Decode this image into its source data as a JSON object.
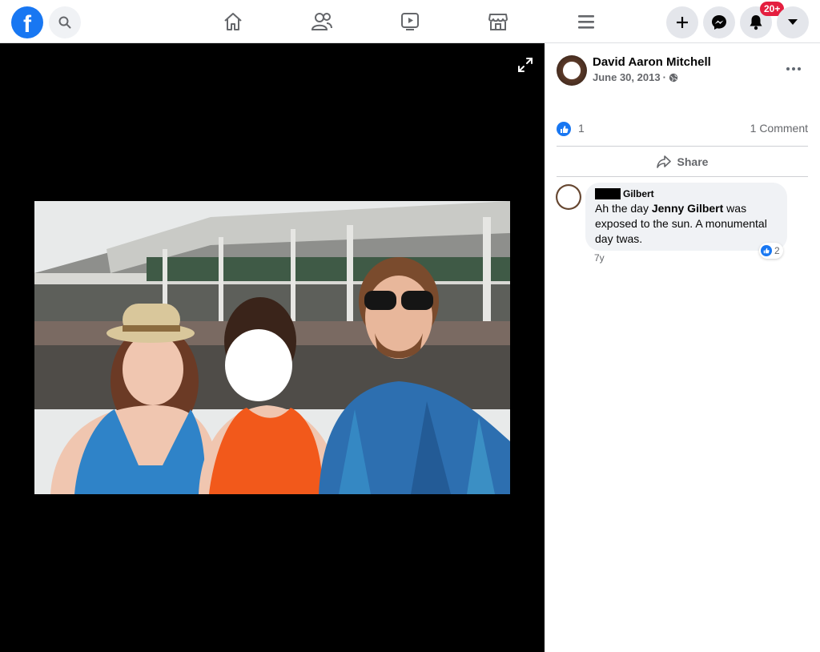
{
  "nav": {
    "logo_letter": "f",
    "search_icon": "search-icon",
    "items": [
      "home-icon",
      "friends-icon",
      "watch-icon",
      "marketplace-icon",
      "menu-icon"
    ],
    "actions": [
      "create-icon",
      "messenger-icon",
      "notifications-icon",
      "account-icon"
    ],
    "notifications_badge": "20+"
  },
  "post": {
    "author": "David Aaron Mitchell",
    "date": "June 30, 2013",
    "date_separator": "·",
    "privacy_icon": "globe-icon",
    "like_count": "1",
    "comment_count": "1 Comment",
    "share_label": "Share"
  },
  "comment": {
    "name": "Gilbert",
    "text_pre": "Ah the day ",
    "mention": "Jenny Gilbert",
    "text_post": " was exposed to the sun. A monumental day twas.",
    "reaction_count": "2",
    "time": "7y"
  },
  "colors": {
    "brand": "#1877f2",
    "badge": "#e41e3f",
    "viewer_bg": "#000000"
  }
}
